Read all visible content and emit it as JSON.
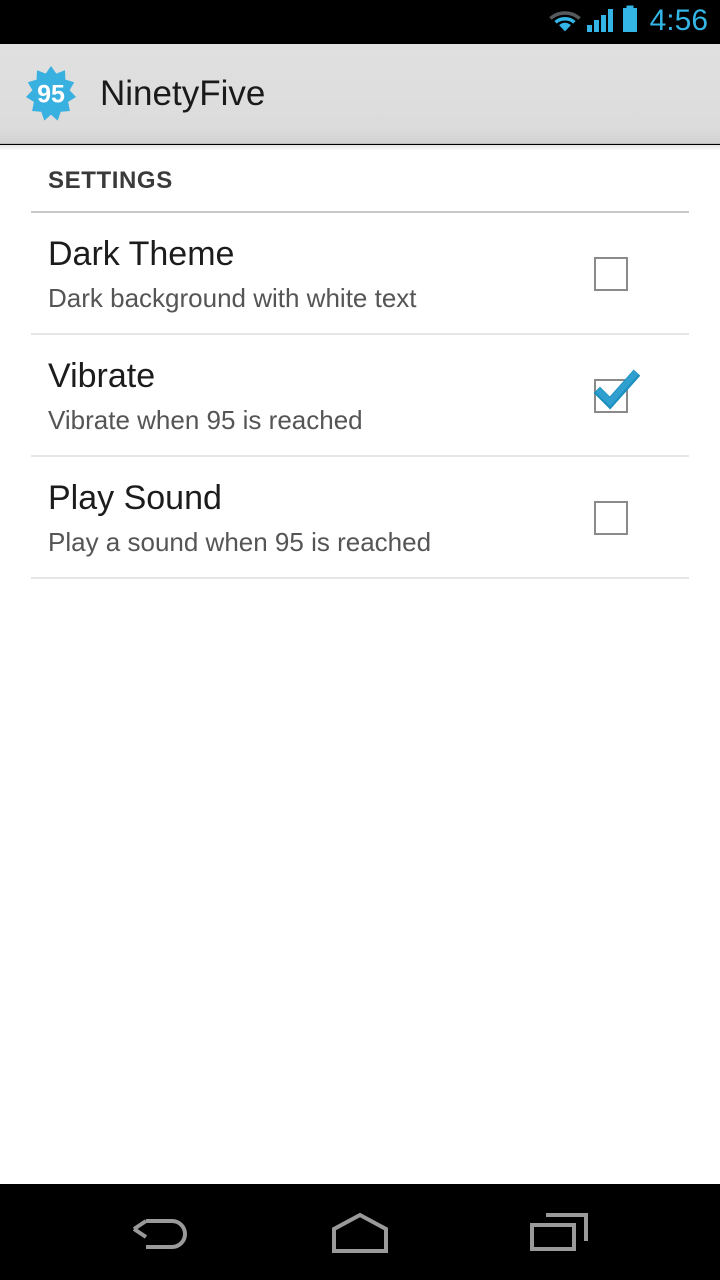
{
  "status_bar": {
    "time": "4:56",
    "accent_color": "#33b5e5",
    "background": "#000000",
    "icons": [
      "wifi-icon",
      "cellular-signal-icon",
      "battery-icon"
    ]
  },
  "action_bar": {
    "title": "NinetyFive",
    "icon_label": "95",
    "icon_name": "app-logo-badge-icon",
    "background": "#dcdcdc",
    "accent_color": "#33b5e5"
  },
  "settings": {
    "section_title": "SETTINGS",
    "preferences": [
      {
        "title": "Dark Theme",
        "summary": "Dark background with white text",
        "checked": false
      },
      {
        "title": "Vibrate",
        "summary": "Vibrate when 95 is reached",
        "checked": true
      },
      {
        "title": "Play Sound",
        "summary": "Play a sound when 95 is reached",
        "checked": false
      }
    ]
  },
  "nav_bar": {
    "buttons": [
      {
        "name": "back-button",
        "icon": "back-arrow-icon"
      },
      {
        "name": "home-button",
        "icon": "home-icon"
      },
      {
        "name": "recents-button",
        "icon": "recent-apps-icon"
      }
    ],
    "icon_color": "#9a9a9a",
    "background": "#000000"
  }
}
